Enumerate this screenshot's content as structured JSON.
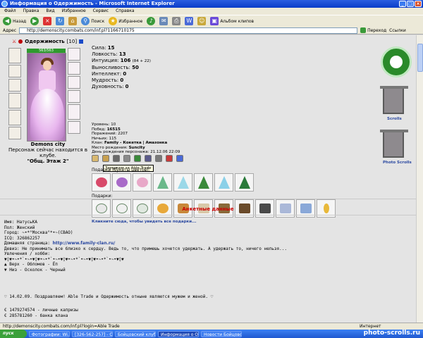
{
  "window": {
    "title": "Информация о Одержимость - Microsoft Internet Explorer",
    "buttons": [
      "_",
      "□",
      "×"
    ]
  },
  "menu": [
    "Файл",
    "Правка",
    "Вид",
    "Избранное",
    "Сервис",
    "Справка"
  ],
  "toolbar": {
    "back": "Назад",
    "search": "Поиск",
    "favorites": "Избранное",
    "album": "Альбом клипов"
  },
  "address": {
    "label": "Адрес",
    "url": "http://demonscity.combats.com/inf.pl?1166710175",
    "go": "Переход",
    "links": "Ссылки"
  },
  "character": {
    "name": "Одержимость",
    "level": "[10]",
    "hp": "563/563",
    "city": "Demons city",
    "location_line": "Персонаж сейчас находится в клубе.",
    "room": "\"Общ. Этаж 2\""
  },
  "stats": [
    {
      "label": "Сила:",
      "value": "15"
    },
    {
      "label": "Ловкость:",
      "value": "13"
    },
    {
      "label": "Интуиция:",
      "value": "106",
      "extra": "(84 + 22)"
    },
    {
      "label": "Выносливость:",
      "value": "50"
    },
    {
      "label": "Интеллект:",
      "value": "0"
    },
    {
      "label": "Мудрость:",
      "value": "0"
    },
    {
      "label": "Духовность:",
      "value": "0"
    }
  ],
  "details": [
    {
      "label": "Уровень:",
      "value": "10"
    },
    {
      "label": "Побед:",
      "value": "16515"
    },
    {
      "label": "Поражений:",
      "value": "2207"
    },
    {
      "label": "Ничьих:",
      "value": "115"
    },
    {
      "label": "Клан:",
      "value": "Family - Кокетка | Амазонка"
    },
    {
      "label": "Место рождения:",
      "value": "Suncity"
    },
    {
      "label": "День рождения персонажа:",
      "value": "21.12.06 22:09"
    }
  ],
  "tooltip": "Замужем за Able Trade",
  "gifts": {
    "flowers_label": "Подарки (букеты цветов):",
    "gifts_label": "Подарки:",
    "link": "Кликните сюда, чтобы увидеть все подарки..."
  },
  "right_panel": {
    "scrolls": "Scrolls",
    "photo_scrolls": "Photo Scrolls"
  },
  "profile": {
    "title": "Анкетные данные",
    "name": "Имя: НатусьКА",
    "sex": "Пол: Женский",
    "town": "Город: ~•*°Москва°*•~(СВАО)",
    "icq": "ICQ: 326862257",
    "homepage_label": "Домашняя страница:",
    "homepage": "http://www.family-clan.ru/",
    "motto": "Девиз: Не принимать все близко к сердцу. Ведь то, что примешь хочется удержать. А удержать то, ничего нельзя...",
    "hobby": "Увлечения / хобби:",
    "ornament": "▼◊▼•~•*`•~•▼◊▼•~•*`•~•▼◊▼•~•*`•~•▼◊▼•~•*`•~•▼◊▼",
    "up": "▲ Верх - Обломов - Ёп",
    "down": "▼ Низ - Осколок - Черный",
    "announcement": "♡ 14.02.09. Поздравляем! Able Trade и Одержимость отныне являются мужем и женой. ♡",
    "line1": "€ 1479274574 - личные капризы",
    "line2": "€ 285781260 - банка клана"
  },
  "status": {
    "text": "http://demonscity.combats.com/inf.pl?login=Able Trade",
    "zone": "Интернет"
  },
  "taskbar": {
    "start": "пуск",
    "tasks": [
      "Фотографии: Wi...",
      "[326-562-257] - Окно...",
      "Бойцовский клуб - Mi...",
      "Информация о Одер...",
      "Новости Бойцовског..."
    ]
  },
  "watermark": "photo-scrolls.ru",
  "colors": {
    "title_bar": "#0a3cc8",
    "hp_bar": "#2e9a2e",
    "link": "#2a48a0",
    "section_title": "#cc0000"
  }
}
